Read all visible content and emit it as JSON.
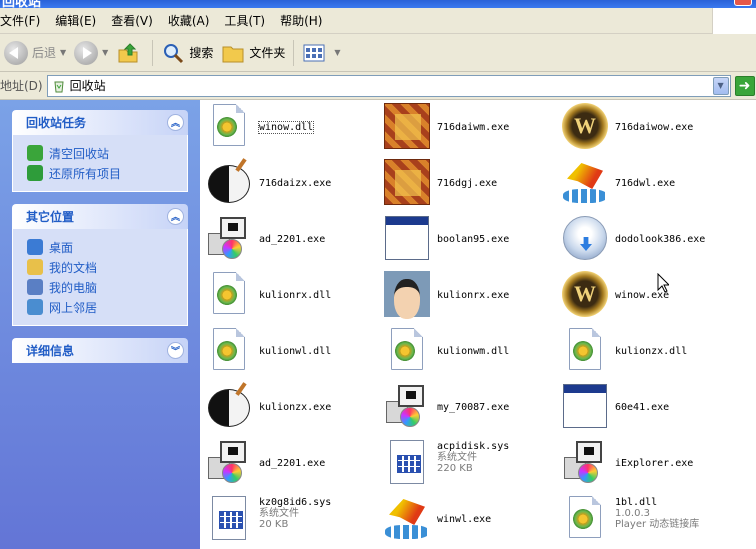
{
  "window": {
    "title": "回收站"
  },
  "menu": [
    {
      "label": "文件(F)",
      "name": "menu-file"
    },
    {
      "label": "编辑(E)",
      "name": "menu-edit"
    },
    {
      "label": "查看(V)",
      "name": "menu-view"
    },
    {
      "label": "收藏(A)",
      "name": "menu-favorites"
    },
    {
      "label": "工具(T)",
      "name": "menu-tools"
    },
    {
      "label": "帮助(H)",
      "name": "menu-help"
    }
  ],
  "toolbar": {
    "back_label": "后退",
    "search_label": "搜索",
    "folders_label": "文件夹"
  },
  "address": {
    "label": "地址(D)",
    "value": "回收站"
  },
  "taskpane": {
    "panels": [
      {
        "title": "回收站任务",
        "collapsed": false,
        "tasks": [
          {
            "label": "清空回收站",
            "icon": "empty-bin-icon",
            "color": "#3aa53a"
          },
          {
            "label": "还原所有项目",
            "icon": "restore-icon",
            "color": "#2e9c3a"
          }
        ]
      },
      {
        "title": "其它位置",
        "collapsed": false,
        "tasks": [
          {
            "label": "桌面",
            "icon": "desktop-icon",
            "color": "#3b7bd4"
          },
          {
            "label": "我的文档",
            "icon": "documents-icon",
            "color": "#e8c04a"
          },
          {
            "label": "我的电脑",
            "icon": "computer-icon",
            "color": "#5a7fc4"
          },
          {
            "label": "网上邻居",
            "icon": "network-icon",
            "color": "#4a8dd0"
          }
        ]
      },
      {
        "title": "详细信息",
        "collapsed": true,
        "tasks": []
      }
    ]
  },
  "files": [
    {
      "name": "winow.dll",
      "icon": "dll-icon",
      "selected": true
    },
    {
      "name": "716daiwm.exe",
      "icon": "game-tile-icon"
    },
    {
      "name": "716daiwow.exe",
      "icon": "warcraft-icon"
    },
    {
      "name": "716daizx.exe",
      "icon": "yin-yang-icon"
    },
    {
      "name": "716dgj.exe",
      "icon": "game-tile-icon"
    },
    {
      "name": "716dwl.exe",
      "icon": "wu-icon"
    },
    {
      "name": "ad_2201.exe",
      "icon": "setup-icon"
    },
    {
      "name": "boolan95.exe",
      "icon": "window-icon"
    },
    {
      "name": "dodolook386.exe",
      "icon": "dodo-icon"
    },
    {
      "name": "kulionrx.dll",
      "icon": "dll-icon"
    },
    {
      "name": "kulionrx.exe",
      "icon": "face-icon"
    },
    {
      "name": "winow.exe",
      "icon": "warcraft-icon"
    },
    {
      "name": "kulionwl.dll",
      "icon": "dll-icon"
    },
    {
      "name": "kulionwm.dll",
      "icon": "dll-icon"
    },
    {
      "name": "kulionzx.dll",
      "icon": "dll-icon"
    },
    {
      "name": "kulionzx.exe",
      "icon": "yin-yang-icon"
    },
    {
      "name": "my_70087.exe",
      "icon": "setup-icon"
    },
    {
      "name": "60e41.exe",
      "icon": "window-icon"
    },
    {
      "name": "ad_2201.exe",
      "icon": "setup-icon"
    },
    {
      "name": "acpidisk.sys",
      "icon": "sys-icon",
      "type": "系统文件",
      "size": "220 KB"
    },
    {
      "name": "iExplorer.exe",
      "icon": "setup-icon"
    },
    {
      "name": "kz0g8id6.sys",
      "icon": "sys-icon",
      "type": "系统文件",
      "size": "20 KB"
    },
    {
      "name": "winwl.exe",
      "icon": "wu-icon"
    },
    {
      "name": "1bl.dll",
      "icon": "dll-icon",
      "type": "1.0.0.3",
      "size": "Player 动态链接库"
    }
  ]
}
